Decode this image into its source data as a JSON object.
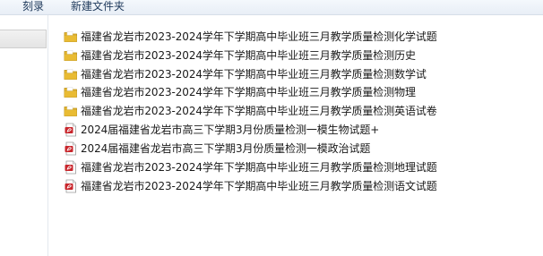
{
  "toolbar": {
    "burn_label": "刻录",
    "new_folder_label": "新建文件夹"
  },
  "files": [
    {
      "type": "folder",
      "icon": "folder-icon",
      "name": "福建省龙岩市2023-2024学年下学期高中毕业班三月教学质量检测化学试题"
    },
    {
      "type": "folder",
      "icon": "folder-icon",
      "name": "福建省龙岩市2023-2024学年下学期高中毕业班三月教学质量检测历史"
    },
    {
      "type": "folder",
      "icon": "folder-icon",
      "name": "福建省龙岩市2023-2024学年下学期高中毕业班三月教学质量检测数学试"
    },
    {
      "type": "folder",
      "icon": "folder-icon",
      "name": "福建省龙岩市2023-2024学年下学期高中毕业班三月教学质量检测物理"
    },
    {
      "type": "folder",
      "icon": "folder-icon",
      "name": "福建省龙岩市2023-2024学年下学期高中毕业班三月教学质量检测英语试卷"
    },
    {
      "type": "pdf",
      "icon": "pdf-icon",
      "name": "2024届福建省龙岩市高三下学期3月份质量检测一模生物试题+"
    },
    {
      "type": "pdf",
      "icon": "pdf-icon",
      "name": "2024届福建省龙岩市高三下学期3月份质量检测一模政治试题"
    },
    {
      "type": "pdf",
      "icon": "pdf-icon",
      "name": "福建省龙岩市2023-2024学年下学期高中毕业班三月教学质量检测地理试题"
    },
    {
      "type": "pdf",
      "icon": "pdf-icon",
      "name": "福建省龙岩市2023-2024学年下学期高中毕业班三月教学质量检测语文试题"
    }
  ],
  "colors": {
    "folder": "#e8b930",
    "pdf": "#c8262c"
  }
}
